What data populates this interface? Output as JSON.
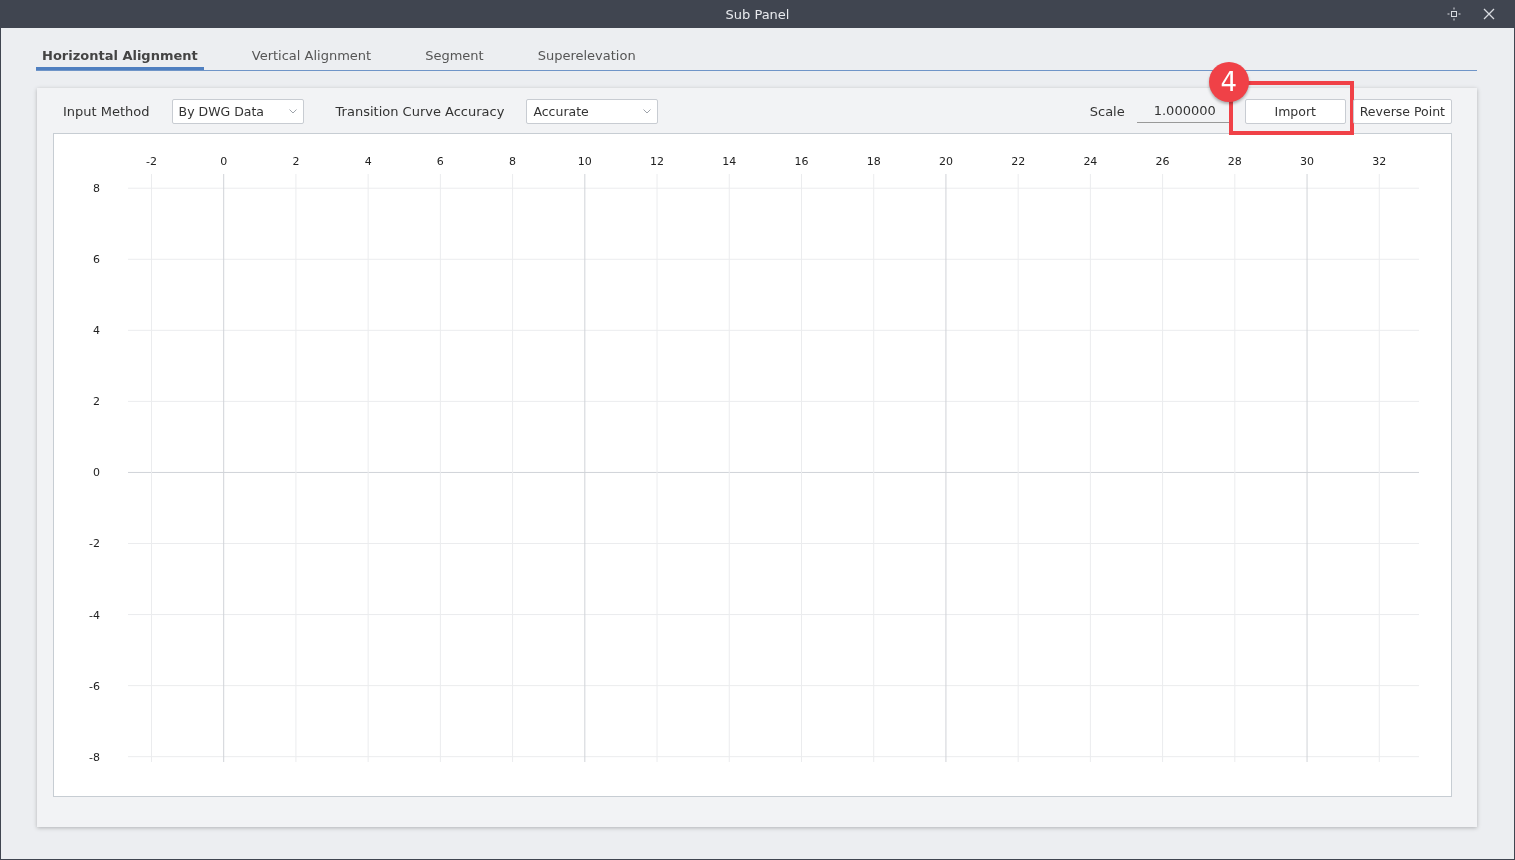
{
  "window": {
    "title": "Sub Panel"
  },
  "tabs": [
    {
      "label": "Horizontal Alignment",
      "selected": true
    },
    {
      "label": "Vertical Alignment",
      "selected": false
    },
    {
      "label": "Segment",
      "selected": false
    },
    {
      "label": "Superelevation",
      "selected": false
    }
  ],
  "toolbar": {
    "input_method": {
      "label": "Input Method",
      "value": "By DWG Data"
    },
    "transition_curve_accuracy": {
      "label": "Transition Curve Accuracy",
      "value": "Accurate"
    },
    "scale": {
      "label": "Scale",
      "value": "1.000000"
    },
    "buttons": [
      {
        "label": "Import",
        "highlighted": true
      },
      {
        "label": "Reverse Point",
        "highlighted": false
      }
    ]
  },
  "callout": {
    "number": "4"
  },
  "plot": {
    "chart_data": {
      "type": "line",
      "grid": true,
      "xlim": [
        -2.65,
        33.1
      ],
      "ylim": [
        -8.15,
        8.4
      ],
      "xticks": [
        -2,
        0,
        2,
        4,
        6,
        8,
        10,
        12,
        14,
        16,
        18,
        20,
        22,
        24,
        26,
        28,
        30,
        32
      ],
      "yticks": [
        8,
        6,
        4,
        2,
        0,
        -2,
        -4,
        -6,
        -8
      ]
    }
  }
}
